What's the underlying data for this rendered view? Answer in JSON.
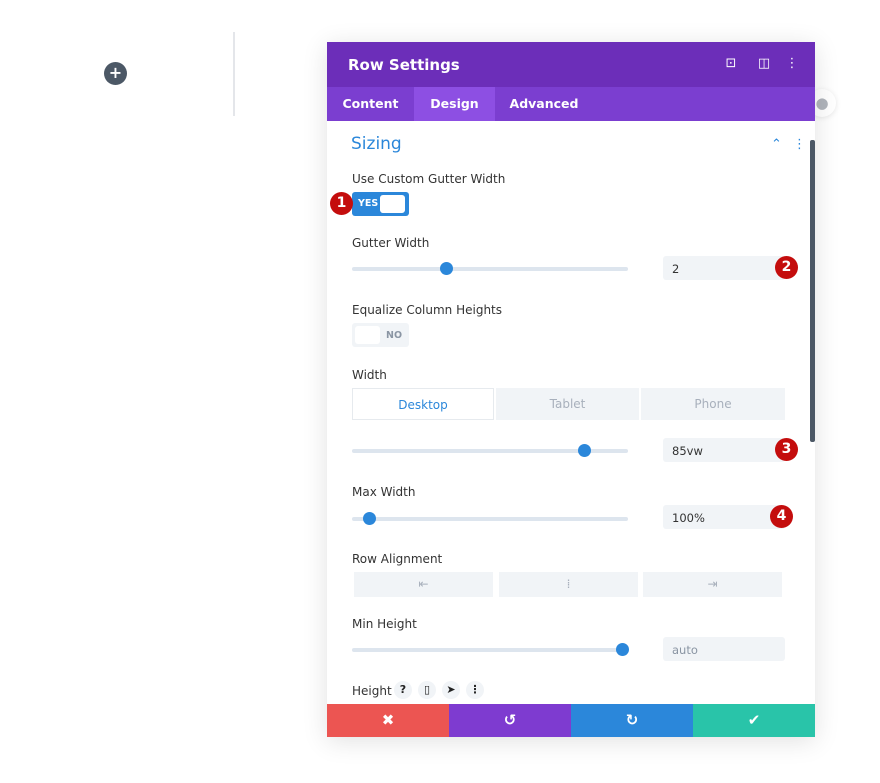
{
  "canvas": {
    "add_icon": "plus-icon"
  },
  "panel": {
    "title": "Row Settings",
    "header_icons": [
      "fullscreen-icon",
      "sidebar-toggle-icon",
      "more-vertical-icon"
    ],
    "tabs": [
      {
        "label": "Content",
        "active": false
      },
      {
        "label": "Design",
        "active": true
      },
      {
        "label": "Advanced",
        "active": false
      }
    ],
    "section": {
      "title": "Sizing",
      "expanded": true
    },
    "custom_gutter": {
      "label": "Use Custom Gutter Width",
      "value": "YES",
      "on": true
    },
    "gutter_width": {
      "label": "Gutter Width",
      "value": "2",
      "slider_percent": 34
    },
    "equalize": {
      "label": "Equalize Column Heights",
      "value": "NO",
      "on": false
    },
    "width": {
      "label": "Width",
      "devices": [
        "Desktop",
        "Tablet",
        "Phone"
      ],
      "active_device": "Desktop",
      "value": "85vw",
      "slider_percent": 84
    },
    "max_width": {
      "label": "Max Width",
      "value": "100%",
      "slider_percent": 6
    },
    "row_alignment": {
      "label": "Row Alignment",
      "options": [
        "align-left-icon",
        "align-center-icon",
        "align-right-icon"
      ]
    },
    "min_height": {
      "label": "Min Height",
      "value": "auto",
      "slider_percent": 98
    },
    "height": {
      "label": "Height",
      "icons": [
        "help-icon",
        "responsive-icon",
        "hover-icon",
        "more-icon"
      ],
      "help_glyph": "?"
    },
    "markers": [
      "1",
      "2",
      "3",
      "4"
    ],
    "footer": {
      "colors": {
        "cancel": "#ec5552",
        "undo": "#7e3bd0",
        "redo": "#2b87da",
        "save": "#29c4a9"
      }
    }
  },
  "colors": {
    "header": "#6c2eb9",
    "tabs": "#7b3ed0",
    "accent": "#2b87da",
    "marker": "#c40d0d"
  }
}
